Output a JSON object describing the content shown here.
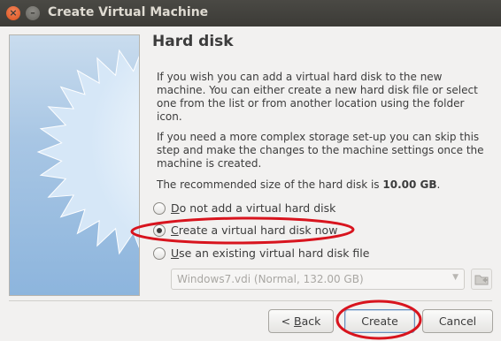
{
  "window": {
    "title": "Create Virtual Machine",
    "close_glyph": "×",
    "min_glyph": "–"
  },
  "page": {
    "heading": "Hard disk",
    "para1": "If you wish you can add a virtual hard disk to the new machine. You can either create a new hard disk file or select one from the list or from another location using the folder icon.",
    "para2": "If you need a more complex storage set-up you can skip this step and make the changes to the machine settings once the machine is created.",
    "para3_prefix": "The recommended size of the hard disk is ",
    "para3_size": "10.00 GB",
    "para3_suffix": "."
  },
  "options": [
    {
      "label_mnemonic": "D",
      "label_rest": "o not add a virtual hard disk",
      "selected": false
    },
    {
      "label_mnemonic": "C",
      "label_rest": "reate a virtual hard disk now",
      "selected": true
    },
    {
      "label_mnemonic": "U",
      "label_rest": "se an existing virtual hard disk file",
      "selected": false
    }
  ],
  "disk_select": {
    "value": "Windows7.vdi (Normal, 132.00 GB)",
    "enabled": false
  },
  "buttons": {
    "back_prefix": "< ",
    "back_mnemonic": "B",
    "back_rest": "ack",
    "create": "Create",
    "cancel": "Cancel"
  },
  "icons": {
    "banner": "starburst-icon",
    "folder": "folder-icon",
    "dropdown": "chevron-down-icon"
  },
  "colors": {
    "annotation": "#d8141e",
    "titlebar": "#3c3b37",
    "close_button": "#e5632f"
  }
}
